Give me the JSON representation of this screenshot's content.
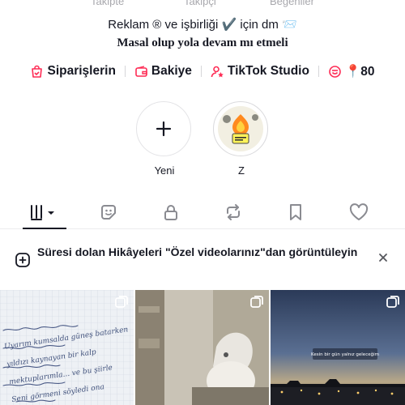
{
  "stats": {
    "following_label": "Takipte",
    "followers_label": "Takipçi",
    "likes_label": "Beğeniler"
  },
  "bio": {
    "line1": "Reklam ® ve işbirliği ✔️ için dm 📨",
    "line2": "Masal olup yola devam mı etmeli"
  },
  "links": {
    "orders": "Siparişlerin",
    "balance": "Bakiye",
    "studio": "TikTok Studio",
    "extra_value": "📍80"
  },
  "stories": {
    "new_label": "Yeni",
    "highlight_label": "Z"
  },
  "tabs": [
    "videos",
    "reposts-stickers",
    "private",
    "reposts",
    "favorites",
    "liked"
  ],
  "banner": {
    "text": "Süresi dolan Hikâyeleri \"Özel videolarınız\"dan görüntüleyin"
  },
  "grid": {
    "cell1_text": "Uyarım kumsalda güneş batarken, yıldızı kaynayan… Seni görmeni söyledi…",
    "cell3_caption": "Kesin bir gün yalnız geleceğim"
  },
  "colors": {
    "accent": "#fe2c55",
    "text": "#161823",
    "muted": "#a8a8ad"
  }
}
